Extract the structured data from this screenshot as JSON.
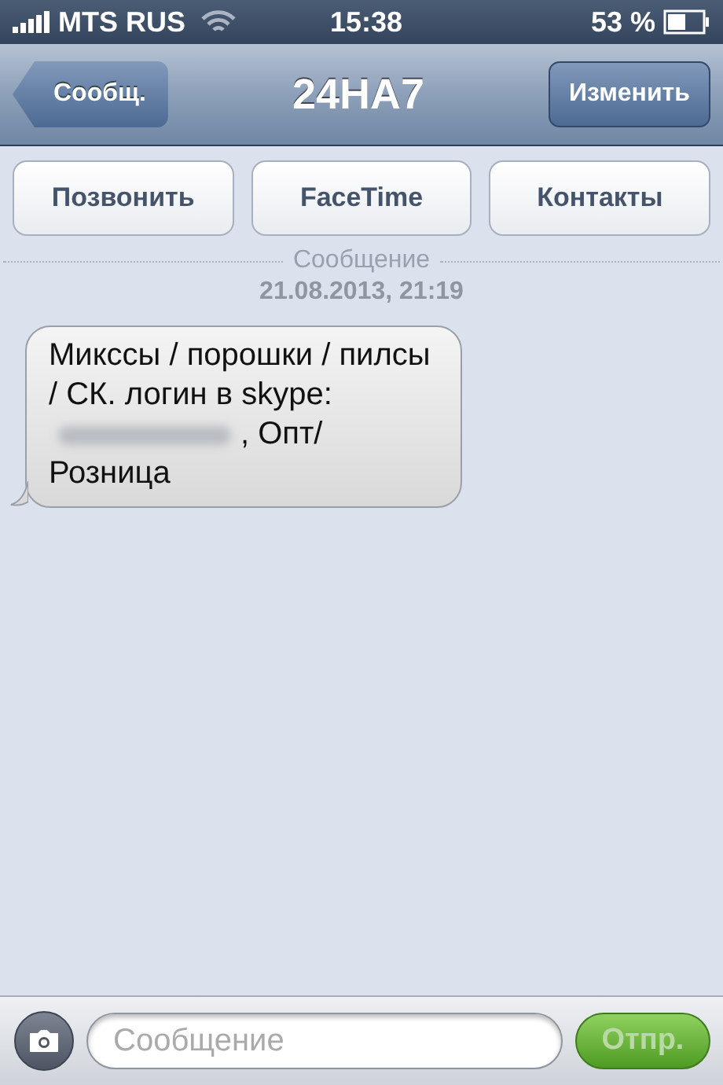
{
  "status_bar": {
    "carrier": "MTS RUS",
    "time": "15:38",
    "battery": "53 %"
  },
  "nav_bar": {
    "back": "Сообщ.",
    "title": "24HA7",
    "edit": "Изменить"
  },
  "actions": [
    "Позвонить",
    "FaceTime",
    "Контакты"
  ],
  "thread": {
    "service": "Сообщение",
    "date": "21.08.2013, 21:19"
  },
  "messages": [
    {
      "text_before": "Микссы / порошки / пилсы / СК. логин в skype:",
      "redacted": true,
      "text_after": ", Опт/ Розница"
    }
  ],
  "composer": {
    "placeholder": "Сообщение",
    "send": "Отпр.",
    "send_disabled": true
  }
}
